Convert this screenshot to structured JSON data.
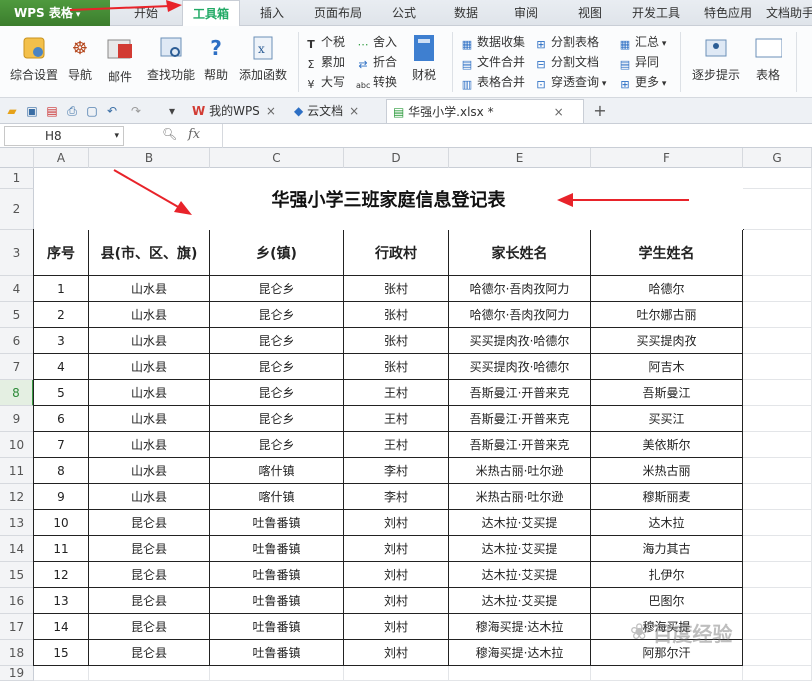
{
  "menubar": {
    "app_name": "WPS 表格",
    "tabs": [
      "开始",
      "工具箱",
      "插入",
      "页面布局",
      "公式",
      "数据",
      "审阅",
      "视图",
      "开发工具",
      "特色应用",
      "文档助手"
    ],
    "active_tab": "工具箱"
  },
  "ribbon": {
    "big_buttons": [
      "综合设置",
      "导航",
      "邮件",
      "查找功能",
      "帮助",
      "添加函数",
      "财税",
      "逐步提示",
      "表格"
    ],
    "small_buttons": {
      "tax_group": [
        "个税",
        "累加",
        "大写"
      ],
      "round_group": [
        "舍入",
        "折合",
        "转换"
      ],
      "data_group": [
        "数据收集",
        "文件合并",
        "表格合并"
      ],
      "split_group": [
        "分割表格",
        "分割文档",
        "穿透查询"
      ],
      "summary_group": [
        "汇总",
        "异同",
        "更多"
      ]
    }
  },
  "quickbar": {
    "tabs": [
      {
        "label": "我的WPS",
        "icon": "wps-logo-icon"
      },
      {
        "label": "云文档",
        "icon": "cloud-doc-icon"
      },
      {
        "label": "华强小学.xlsx *",
        "icon": "spreadsheet-icon"
      }
    ],
    "add_tab": "+"
  },
  "formula_bar": {
    "cell_ref": "H8",
    "fx": "fx"
  },
  "sheet": {
    "columns": [
      "A",
      "B",
      "C",
      "D",
      "E",
      "F",
      "G"
    ],
    "rows": [
      "1",
      "2",
      "3",
      "4",
      "5",
      "6",
      "7",
      "8",
      "9",
      "10",
      "11",
      "12",
      "13",
      "14",
      "15",
      "16",
      "17",
      "18",
      "19"
    ],
    "selected_row": "8",
    "title": "华强小学三班家庭信息登记表",
    "headers": [
      "序号",
      "县(市、区、旗)",
      "乡(镇)",
      "行政村",
      "家长姓名",
      "学生姓名"
    ],
    "data": [
      [
        "1",
        "山水县",
        "昆仑乡",
        "张村",
        "哈德尔·吾肉孜阿力",
        "哈德尔"
      ],
      [
        "2",
        "山水县",
        "昆仑乡",
        "张村",
        "哈德尔·吾肉孜阿力",
        "吐尔娜古丽"
      ],
      [
        "3",
        "山水县",
        "昆仑乡",
        "张村",
        "买买提肉孜·哈德尔",
        "买买提肉孜"
      ],
      [
        "4",
        "山水县",
        "昆仑乡",
        "张村",
        "买买提肉孜·哈德尔",
        "阿吉木"
      ],
      [
        "5",
        "山水县",
        "昆仑乡",
        "王村",
        "吾斯曼江·开普来克",
        "吾斯曼江"
      ],
      [
        "6",
        "山水县",
        "昆仑乡",
        "王村",
        "吾斯曼江·开普来克",
        "买买江"
      ],
      [
        "7",
        "山水县",
        "昆仑乡",
        "王村",
        "吾斯曼江·开普来克",
        "美依斯尔"
      ],
      [
        "8",
        "山水县",
        "喀什镇",
        "李村",
        "米热古丽·吐尔逊",
        "米热古丽"
      ],
      [
        "9",
        "山水县",
        "喀什镇",
        "李村",
        "米热古丽·吐尔逊",
        "穆斯丽麦"
      ],
      [
        "10",
        "昆仑县",
        "吐鲁番镇",
        "刘村",
        "达木拉·艾买提",
        "达木拉"
      ],
      [
        "11",
        "昆仑县",
        "吐鲁番镇",
        "刘村",
        "达木拉·艾买提",
        "海力其古"
      ],
      [
        "12",
        "昆仑县",
        "吐鲁番镇",
        "刘村",
        "达木拉·艾买提",
        "扎伊尔"
      ],
      [
        "13",
        "昆仑县",
        "吐鲁番镇",
        "刘村",
        "达木拉·艾买提",
        "巴图尔"
      ],
      [
        "14",
        "昆仑县",
        "吐鲁番镇",
        "刘村",
        "穆海买提·达木拉",
        "穆海买提"
      ],
      [
        "15",
        "昆仑县",
        "吐鲁番镇",
        "刘村",
        "穆海买提·达木拉",
        "阿那尔汗"
      ]
    ]
  },
  "watermark": "百度经验",
  "colors": {
    "accent": "#2e9b3e",
    "arrow": "#e8232a",
    "logo": "#3b7d2d"
  }
}
